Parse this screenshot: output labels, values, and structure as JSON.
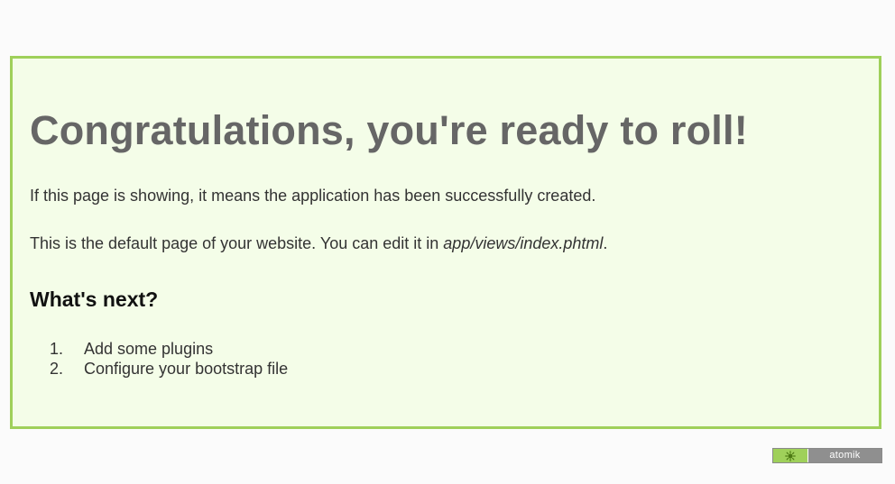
{
  "welcome": {
    "title": "Congratulations, you're ready to roll!",
    "paragraph1": "If this page is showing, it means the application has been successfully created.",
    "paragraph2_prefix": "This is the default page of your website. You can edit it in ",
    "paragraph2_path": "app/views/index.phtml",
    "paragraph2_suffix": ".",
    "whats_next": "What's next?",
    "steps": [
      {
        "number": "1.",
        "label": "Add some plugins"
      },
      {
        "number": "2.",
        "label": "Configure your bootstrap file"
      }
    ]
  },
  "footer": {
    "badge_icon": "atomik-logo-icon",
    "badge_label": "atomik"
  },
  "colors": {
    "box_border": "#9fd05a",
    "box_background": "#f4fde8",
    "title_text": "#666666",
    "badge_label_bg": "#8f8f8f"
  }
}
